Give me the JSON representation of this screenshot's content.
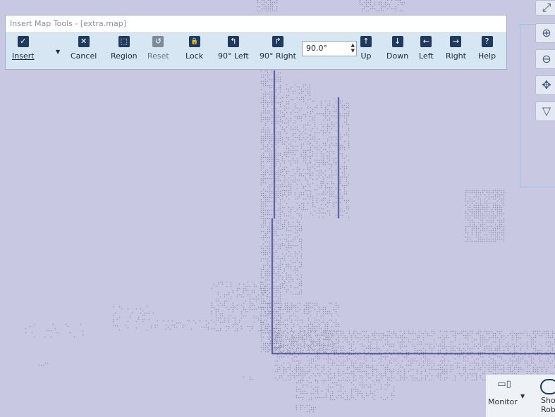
{
  "window": {
    "title": "Insert Map Tools - [extra.map]"
  },
  "toolbar": {
    "buttons": [
      {
        "label": "Insert",
        "icon": "check-icon",
        "glyph": "✓"
      },
      {
        "label": "Cancel",
        "icon": "x-icon",
        "glyph": "✕"
      },
      {
        "label": "Region",
        "icon": "region-icon",
        "glyph": "⬚"
      },
      {
        "label": "Reset",
        "icon": "reset-icon",
        "glyph": "↺",
        "disabled": true
      },
      {
        "label": "Lock",
        "icon": "lock-icon",
        "glyph": "🔒"
      },
      {
        "label": "90° Left",
        "icon": "rotate-left-icon",
        "glyph": "↰"
      },
      {
        "label": "90° Right",
        "icon": "rotate-right-icon",
        "glyph": "↱"
      },
      {
        "label": "Up",
        "icon": "arrow-up-icon",
        "glyph": "↑"
      },
      {
        "label": "Down",
        "icon": "arrow-down-icon",
        "glyph": "↓"
      },
      {
        "label": "Left",
        "icon": "arrow-left-icon",
        "glyph": "←"
      },
      {
        "label": "Right",
        "icon": "arrow-right-icon",
        "glyph": "→"
      },
      {
        "label": "Help",
        "icon": "help-icon",
        "glyph": "?"
      }
    ],
    "rotation_value": "90.0°"
  },
  "side_tools": [
    {
      "name": "zoom-in-icon",
      "glyph": "⊕"
    },
    {
      "name": "zoom-out-icon",
      "glyph": "⊖"
    },
    {
      "name": "pan-icon",
      "glyph": "✥"
    },
    {
      "name": "filter-icon",
      "glyph": "▽"
    }
  ],
  "bottom_panel": {
    "monitor_label": "Monitor",
    "show_robot_label": "Show Robot"
  },
  "colors": {
    "map_background": "#c8c8e2",
    "map_line": "#2a3585",
    "toolbar_bg": "#d6e7f3"
  }
}
